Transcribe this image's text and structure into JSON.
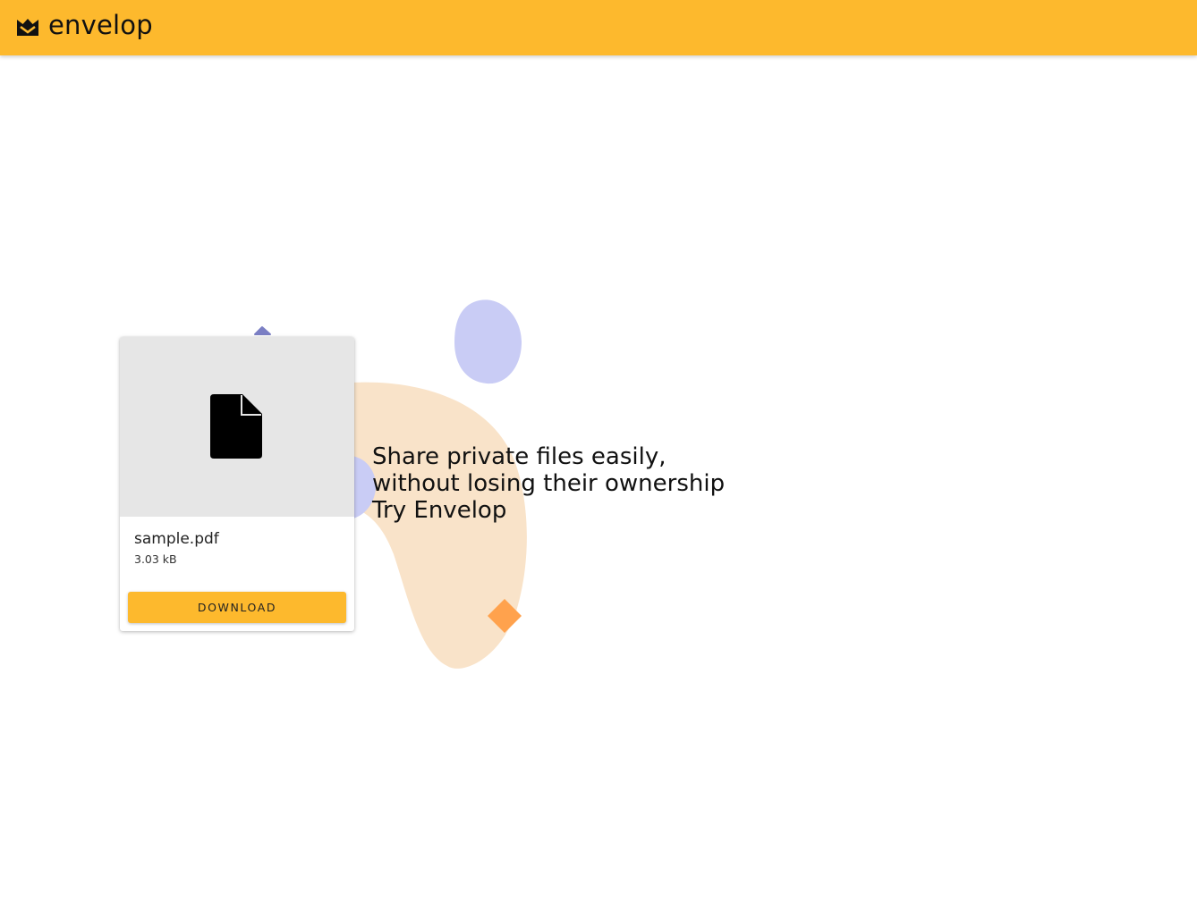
{
  "header": {
    "logo_text": "envelop",
    "brand_color": "#FDB92D",
    "logo_icon": "crown-envelope-icon"
  },
  "file_card": {
    "icon": "file-icon",
    "file_name": "sample.pdf",
    "file_size": "3.03 kB",
    "download_label": "DOWNLOAD"
  },
  "hero": {
    "line1": "Share private files easily,",
    "line2": "without losing their ownership",
    "cta": "Try Envelop"
  },
  "decor_colors": {
    "peach_blob": "#F9E3C9",
    "lavender_blob": "#C9CCF5",
    "purple_triangle": "#7B7FC4",
    "orange_diamond": "#FFA24D"
  }
}
